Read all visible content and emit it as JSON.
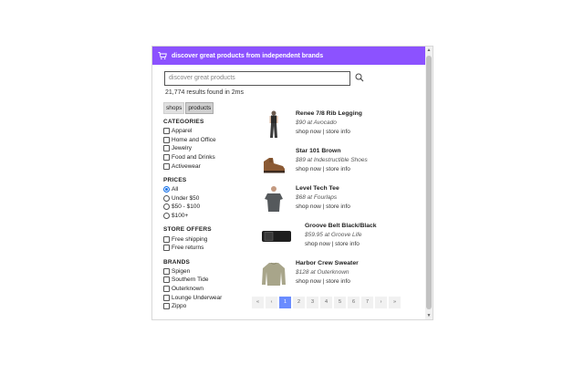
{
  "banner": {
    "text": "discover great products from independent brands",
    "icon": "cart-icon",
    "color": "#8c52ff"
  },
  "search": {
    "placeholder": "discover great products",
    "value": ""
  },
  "results_text": "21,774 results found in 2ms",
  "toggle": {
    "shops": "shops",
    "products": "products",
    "active": "products"
  },
  "filters": {
    "categories": {
      "title": "CATEGORIES",
      "options": [
        "Apparel",
        "Home and Office",
        "Jewelry",
        "Food and Drinks",
        "Activewear"
      ]
    },
    "prices": {
      "title": "PRICES",
      "options": [
        "All",
        "Under $50",
        "$50 - $100",
        "$100+"
      ],
      "selected": "All"
    },
    "store_offers": {
      "title": "STORE OFFERS",
      "options": [
        "Free shipping",
        "Free returns"
      ]
    },
    "brands": {
      "title": "BRANDS",
      "options": [
        "Spigen",
        "Southern Tide",
        "Outerknown",
        "Lounge Underwear",
        "Zippo"
      ]
    }
  },
  "products": [
    {
      "name": "Renee 7/8 Rib Legging",
      "price": "$90 at Avocado",
      "shop": "shop now",
      "sep": "|",
      "info": "store info"
    },
    {
      "name": "Star 101 Brown",
      "price": "$89 at Indestructible Shoes",
      "shop": "shop now",
      "sep": "|",
      "info": "store info"
    },
    {
      "name": "Level Tech Tee",
      "price": "$68 at Fourlaps",
      "shop": "shop now",
      "sep": "|",
      "info": "store info"
    },
    {
      "name": "Groove Belt Black/Black",
      "price": "$59.95 at Groove Life",
      "shop": "shop now",
      "sep": "|",
      "info": "store info"
    },
    {
      "name": "Harbor Crew Sweater",
      "price": "$128 at Outerknown",
      "shop": "shop now",
      "sep": "|",
      "info": "store info"
    }
  ],
  "pagination": {
    "first": "«",
    "prev": "‹",
    "pages": [
      "1",
      "2",
      "3",
      "4",
      "5",
      "6",
      "7"
    ],
    "current": "1",
    "next": "›",
    "last": "»"
  },
  "scroll": {
    "up": "▲",
    "down": "▼"
  }
}
